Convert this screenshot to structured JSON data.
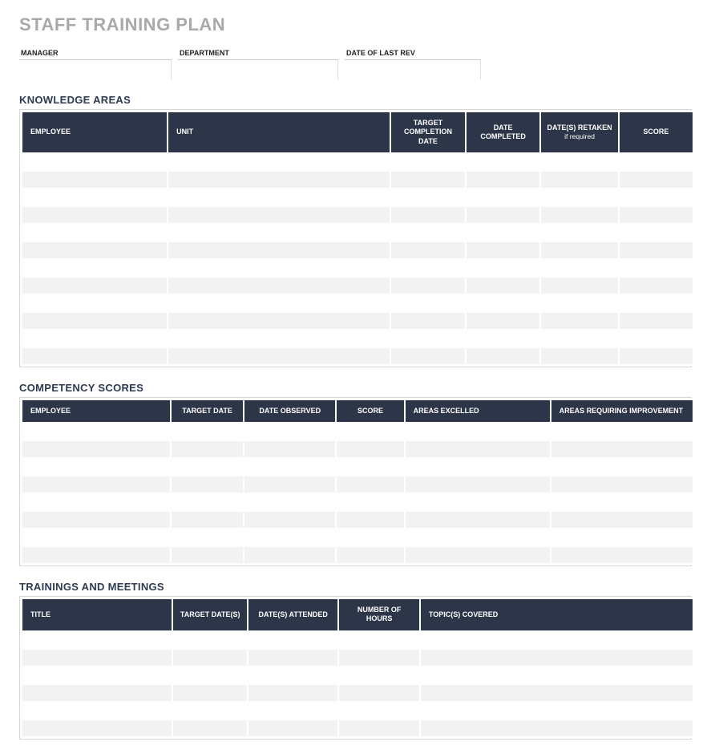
{
  "title": "STAFF TRAINING PLAN",
  "meta": {
    "manager_label": "MANAGER",
    "manager_value": "",
    "department_label": "DEPARTMENT",
    "department_value": "",
    "lastrev_label": "DATE OF LAST REV",
    "lastrev_value": ""
  },
  "sections": {
    "knowledge": {
      "title": "KNOWLEDGE AREAS",
      "headers": {
        "employee": "EMPLOYEE",
        "unit": "UNIT",
        "target": "TARGET COMPLETION DATE",
        "completed": "DATE COMPLETED",
        "retaken": "DATE(S) RETAKEN",
        "retaken_sub": "if required",
        "score": "SCORE"
      },
      "rows": [
        {
          "employee": "",
          "unit": "",
          "target": "",
          "completed": "",
          "retaken": "",
          "score": ""
        },
        {
          "employee": "",
          "unit": "",
          "target": "",
          "completed": "",
          "retaken": "",
          "score": ""
        },
        {
          "employee": "",
          "unit": "",
          "target": "",
          "completed": "",
          "retaken": "",
          "score": ""
        },
        {
          "employee": "",
          "unit": "",
          "target": "",
          "completed": "",
          "retaken": "",
          "score": ""
        },
        {
          "employee": "",
          "unit": "",
          "target": "",
          "completed": "",
          "retaken": "",
          "score": ""
        },
        {
          "employee": "",
          "unit": "",
          "target": "",
          "completed": "",
          "retaken": "",
          "score": ""
        },
        {
          "employee": "",
          "unit": "",
          "target": "",
          "completed": "",
          "retaken": "",
          "score": ""
        },
        {
          "employee": "",
          "unit": "",
          "target": "",
          "completed": "",
          "retaken": "",
          "score": ""
        },
        {
          "employee": "",
          "unit": "",
          "target": "",
          "completed": "",
          "retaken": "",
          "score": ""
        },
        {
          "employee": "",
          "unit": "",
          "target": "",
          "completed": "",
          "retaken": "",
          "score": ""
        },
        {
          "employee": "",
          "unit": "",
          "target": "",
          "completed": "",
          "retaken": "",
          "score": ""
        },
        {
          "employee": "",
          "unit": "",
          "target": "",
          "completed": "",
          "retaken": "",
          "score": ""
        }
      ]
    },
    "competency": {
      "title": "COMPETENCY SCORES",
      "headers": {
        "employee": "EMPLOYEE",
        "target_date": "TARGET DATE",
        "date_observed": "DATE OBSERVED",
        "score": "SCORE",
        "excelled": "AREAS EXCELLED",
        "improve": "AREAS REQUIRING IMPROVEMENT"
      },
      "rows": [
        {
          "employee": "",
          "target_date": "",
          "date_observed": "",
          "score": "",
          "excelled": "",
          "improve": ""
        },
        {
          "employee": "",
          "target_date": "",
          "date_observed": "",
          "score": "",
          "excelled": "",
          "improve": ""
        },
        {
          "employee": "",
          "target_date": "",
          "date_observed": "",
          "score": "",
          "excelled": "",
          "improve": ""
        },
        {
          "employee": "",
          "target_date": "",
          "date_observed": "",
          "score": "",
          "excelled": "",
          "improve": ""
        },
        {
          "employee": "",
          "target_date": "",
          "date_observed": "",
          "score": "",
          "excelled": "",
          "improve": ""
        },
        {
          "employee": "",
          "target_date": "",
          "date_observed": "",
          "score": "",
          "excelled": "",
          "improve": ""
        },
        {
          "employee": "",
          "target_date": "",
          "date_observed": "",
          "score": "",
          "excelled": "",
          "improve": ""
        },
        {
          "employee": "",
          "target_date": "",
          "date_observed": "",
          "score": "",
          "excelled": "",
          "improve": ""
        }
      ]
    },
    "trainings": {
      "title": "TRAININGS AND MEETINGS",
      "headers": {
        "title": "TITLE",
        "target_dates": "TARGET DATE(S)",
        "dates_attended": "DATE(S) ATTENDED",
        "hours": "NUMBER OF HOURS",
        "topics": "TOPIC(S) COVERED"
      },
      "rows": [
        {
          "title": "",
          "target_dates": "",
          "dates_attended": "",
          "hours": "",
          "topics": ""
        },
        {
          "title": "",
          "target_dates": "",
          "dates_attended": "",
          "hours": "",
          "topics": ""
        },
        {
          "title": "",
          "target_dates": "",
          "dates_attended": "",
          "hours": "",
          "topics": ""
        },
        {
          "title": "",
          "target_dates": "",
          "dates_attended": "",
          "hours": "",
          "topics": ""
        },
        {
          "title": "",
          "target_dates": "",
          "dates_attended": "",
          "hours": "",
          "topics": ""
        },
        {
          "title": "",
          "target_dates": "",
          "dates_attended": "",
          "hours": "",
          "topics": ""
        }
      ]
    }
  }
}
